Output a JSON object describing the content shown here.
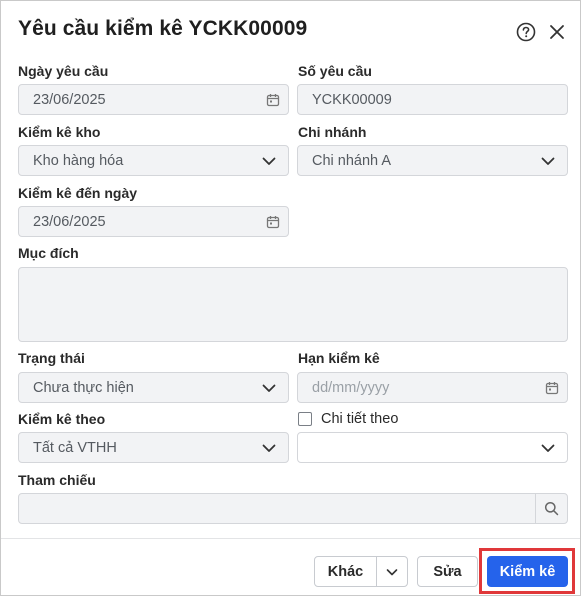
{
  "dialog": {
    "title": "Yêu cầu kiểm kê YCKK00009"
  },
  "form": {
    "request_date": {
      "label": "Ngày yêu cầu",
      "value": "23/06/2025"
    },
    "request_no": {
      "label": "Số yêu cầu",
      "value": "YCKK00009"
    },
    "warehouse": {
      "label": "Kiểm kê kho",
      "value": "Kho hàng hóa"
    },
    "branch": {
      "label": "Chi nhánh",
      "value": "Chi nhánh A"
    },
    "to_date": {
      "label": "Kiểm kê đến ngày",
      "value": "23/06/2025"
    },
    "purpose": {
      "label": "Mục đích",
      "value": ""
    },
    "status": {
      "label": "Trạng thái",
      "value": "Chưa thực hiện"
    },
    "deadline": {
      "label": "Hạn kiểm kê",
      "placeholder": "dd/mm/yyyy"
    },
    "count_by": {
      "label": "Kiểm kê theo",
      "value": "Tất cả VTHH"
    },
    "detail_by": {
      "label": "Chi tiết theo",
      "checked": false,
      "value": ""
    },
    "reference": {
      "label": "Tham chiếu",
      "value": ""
    }
  },
  "footer": {
    "other_label": "Khác",
    "edit_label": "Sửa",
    "inventory_label": "Kiểm kê"
  },
  "colors": {
    "primary": "#2563eb",
    "highlight": "#e0383a",
    "field_bg": "#f2f3f5"
  },
  "icons": [
    "help-icon",
    "close-icon",
    "calendar-icon",
    "chevron-down-icon",
    "search-icon"
  ]
}
